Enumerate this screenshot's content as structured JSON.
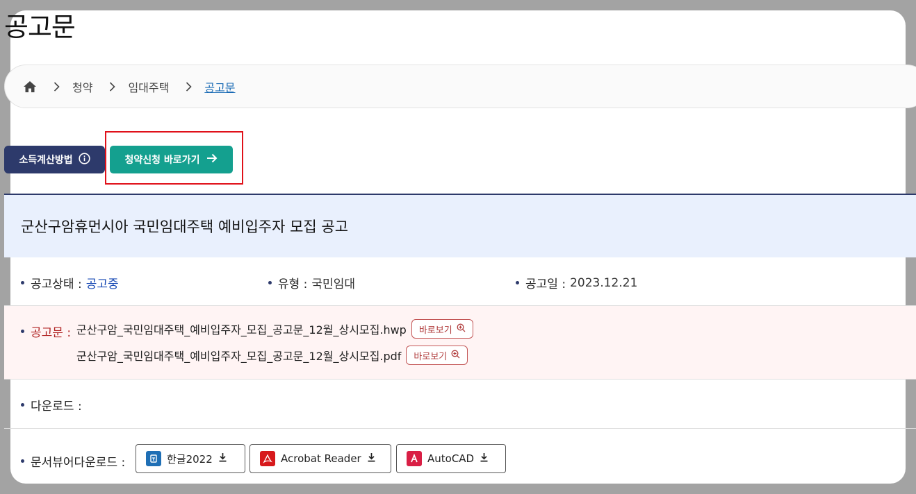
{
  "page": {
    "title": "공고문"
  },
  "breadcrumb": {
    "items": [
      "청약",
      "임대주택",
      "공고문"
    ]
  },
  "actions": {
    "income_method_label": "소득계산방법",
    "apply_shortcut_label": "청약신청 바로가기"
  },
  "notice": {
    "title": "군산구암휴먼시아 국민임대주택 예비입주자 모집 공고",
    "status_label": "공고상태 :",
    "status_value": "공고중",
    "type_label": "유형 :",
    "type_value": "국민임대",
    "date_label": "공고일 :",
    "date_value": "2023.12.21",
    "docs_label": "공고문 :",
    "files": [
      {
        "name": "군산구암_국민임대주택_예비입주자_모집_공고문_12월_상시모집.hwp",
        "view_label": "바로보기"
      },
      {
        "name": "군산구암_국민임대주택_예비입주자_모집_공고문_12월_상시모집.pdf",
        "view_label": "바로보기"
      }
    ],
    "download_label": "다운로드 :",
    "viewer_label": "문서뷰어다운로드 :"
  },
  "viewers": [
    {
      "label": "한글2022",
      "icon": "hangul-icon",
      "color": "#1f6fb5"
    },
    {
      "label": "Acrobat Reader",
      "icon": "acrobat-icon",
      "color": "#d7191c"
    },
    {
      "label": "AutoCAD",
      "icon": "autocad-icon",
      "color": "#d91f45"
    }
  ],
  "colors": {
    "navy": "#2d3a6b",
    "teal": "#14a08f",
    "highlight": "#e0111a",
    "status": "#1a4bb5",
    "notice_red": "#b02222"
  }
}
